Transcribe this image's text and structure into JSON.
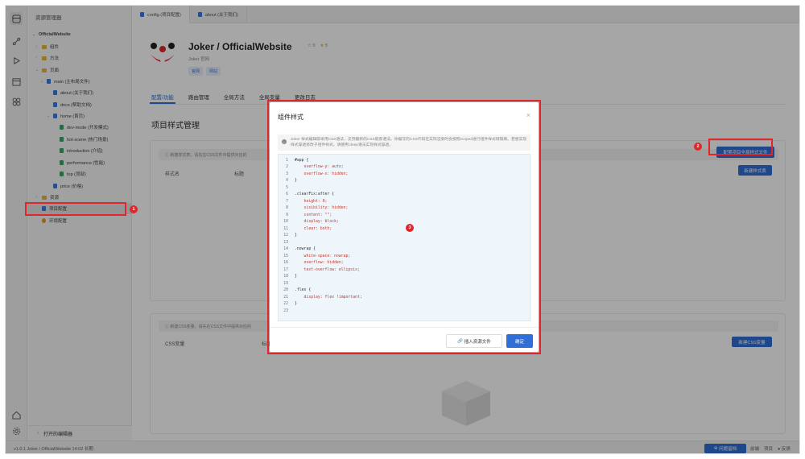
{
  "explorer": {
    "title": "资源管理器",
    "root": "OfficialWebsite",
    "items": [
      {
        "label": "组件",
        "kind": "folder"
      },
      {
        "label": "方法",
        "kind": "folder"
      },
      {
        "label": "页面",
        "kind": "folder"
      },
      {
        "label": "main (主布局文件)",
        "kind": "file"
      },
      {
        "label": "about (关于我们)",
        "kind": "file"
      },
      {
        "label": "docs (帮助文档)",
        "kind": "file"
      },
      {
        "label": "home (首页)",
        "kind": "file"
      },
      {
        "label": "dev-mode (开发模式)",
        "kind": "file"
      },
      {
        "label": "hot-scene (热门场景)",
        "kind": "file"
      },
      {
        "label": "introduction (介绍)",
        "kind": "file"
      },
      {
        "label": "performance (性能)",
        "kind": "file"
      },
      {
        "label": "top (顶部)",
        "kind": "file"
      },
      {
        "label": "price (价格)",
        "kind": "file"
      },
      {
        "label": "资源",
        "kind": "folder"
      },
      {
        "label": "项目配置",
        "kind": "file"
      },
      {
        "label": "环境配置",
        "kind": "file"
      }
    ],
    "open_editors": "打开的编辑器"
  },
  "status": {
    "left": "v1.0.1  Joker / OfficialWebsite  14:02 长期",
    "help_button": "问题留档",
    "right": [
      "前端",
      "项目",
      "反馈"
    ]
  },
  "tabs": [
    {
      "label": "config (项目配置)"
    },
    {
      "label": "about (关于我们)"
    }
  ],
  "project": {
    "title": "Joker / OfficialWebsite",
    "stat_stars": "0",
    "stat_rating": "5",
    "subtitle": "Joker 官网",
    "tags": [
      "官网",
      "网站"
    ]
  },
  "nav": [
    "配置/功能",
    "路由管理",
    "全局方法",
    "全局变量",
    "更改日志"
  ],
  "page": {
    "heading": "项目样式管理",
    "style_note": "新建样式表，请先在CSS文件中提供对应的",
    "col_style_name": "样式名",
    "col_title": "标题",
    "config_button": "配置项目全局样式文件",
    "new_style_button": "新建样式表",
    "css_note": "新建CSS变量，请先在CSS文件中提供对应的",
    "col_css_var": "CSS变量",
    "col_css_title": "标题",
    "new_css_button": "新建CSS变量"
  },
  "modal": {
    "title": "组件样式",
    "close": "×",
    "note": "Joker 样式编辑取采用CSS语法，支持最新的CSS嵌套语法。你编写的CSS代码在实际渲染时会按照scoped进行组件样式域隔离。若想实现样式穿透修改子组件样式，请使用:deep语法实现样式穿透。",
    "code": [
      "#app {",
      "    overflow-y: auto;",
      "    overflow-x: hidden;",
      "}",
      "",
      ".clearFix:after {",
      "    height: 0;",
      "    visibility: hidden;",
      "    content: \"\";",
      "    display: block;",
      "    clear: both;",
      "}",
      "",
      ".nowrap {",
      "    white-space: nowrap;",
      "    overflow: hidden;",
      "    text-overflow: ellipsis;",
      "}",
      "",
      ".flex {",
      "    display: flex !important;",
      "}",
      ""
    ],
    "insert_button": "插入资源文件",
    "ok_button": "确定"
  },
  "badges": [
    "1",
    "2",
    "3"
  ]
}
